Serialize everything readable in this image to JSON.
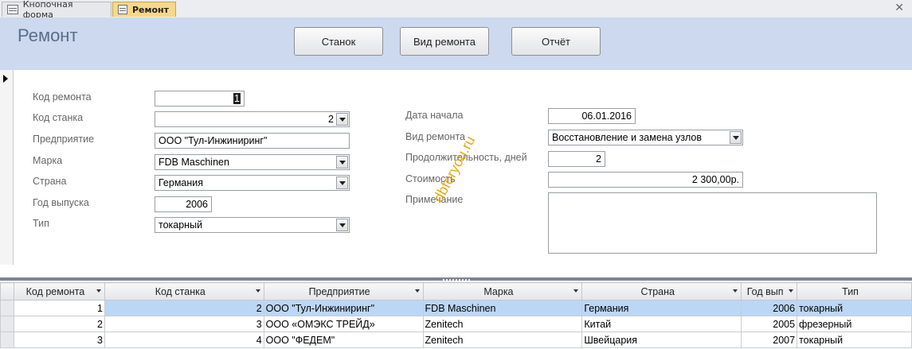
{
  "tabs": [
    {
      "label": "Кнопочная форма",
      "active": false
    },
    {
      "label": "Ремонт",
      "active": true
    }
  ],
  "header": {
    "title": "Ремонт",
    "buttons": [
      "Станок",
      "Вид ремонта",
      "Отчёт"
    ]
  },
  "form": {
    "left": [
      {
        "label": "Код ремонта",
        "value": "1"
      },
      {
        "label": "Код станка",
        "value": "2"
      },
      {
        "label": "Предприятие",
        "value": "ООО \"Тул-Инжиниринг\""
      },
      {
        "label": "Марка",
        "value": "FDB Maschinen"
      },
      {
        "label": "Страна",
        "value": "Германия"
      },
      {
        "label": "Год выпуска",
        "value": "2006"
      },
      {
        "label": "Тип",
        "value": "токарный"
      }
    ],
    "right": [
      {
        "label": "Дата начала",
        "value": "06.01.2016"
      },
      {
        "label": "Вид ремонта",
        "value": "Восстановление и замена узлов"
      },
      {
        "label": "Продолжительность, дней",
        "value": "2"
      },
      {
        "label": "Стоимость",
        "value": "2 300,00р."
      },
      {
        "label": "Примечание",
        "value": ""
      }
    ]
  },
  "watermark": "dbforyou.ru",
  "datasheet": {
    "columns": [
      "Код ремонта",
      "Код станка",
      "Предприятие",
      "Марка",
      "Страна",
      "Год вып",
      "Тип"
    ],
    "rows": [
      [
        "1",
        "2",
        "ООО \"Тул-Инжиниринг\"",
        "FDB Maschinen",
        "Германия",
        "2006",
        "токарный"
      ],
      [
        "2",
        "3",
        "ООО «ОМЭКС ТРЕЙД»",
        "Zenitech",
        "Китай",
        "2005",
        "фрезерный"
      ],
      [
        "3",
        "4",
        "ООО \"ФЕДЕМ\"",
        "Zenitech",
        "Швейцария",
        "2007",
        "токарный"
      ]
    ]
  }
}
